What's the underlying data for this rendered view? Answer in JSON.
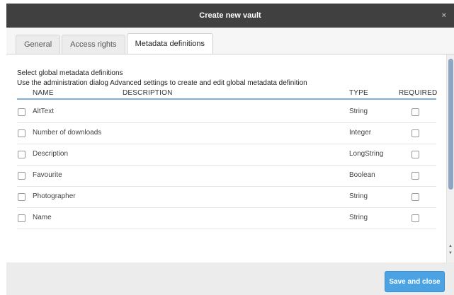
{
  "dialog": {
    "title": "Create new vault",
    "close_label": "×"
  },
  "tabs": [
    {
      "label": "General",
      "active": false
    },
    {
      "label": "Access rights",
      "active": false
    },
    {
      "label": "Metadata definitions",
      "active": true
    }
  ],
  "content": {
    "intro_line1": "Select global metadata definitions",
    "intro_line2": "Use the administration dialog Advanced settings to create and edit global metadata definition"
  },
  "table": {
    "headers": {
      "name": "NAME",
      "description": "DESCRIPTION",
      "type": "TYPE",
      "required": "REQUIRED"
    },
    "rows": [
      {
        "name": "AltText",
        "description": "",
        "type": "String",
        "selected": false,
        "required": false
      },
      {
        "name": "Number of downloads",
        "description": "",
        "type": "Integer",
        "selected": false,
        "required": false
      },
      {
        "name": "Description",
        "description": "",
        "type": "LongString",
        "selected": false,
        "required": false
      },
      {
        "name": "Favourite",
        "description": "",
        "type": "Boolean",
        "selected": false,
        "required": false
      },
      {
        "name": "Photographer",
        "description": "",
        "type": "String",
        "selected": false,
        "required": false
      },
      {
        "name": "Name",
        "description": "",
        "type": "String",
        "selected": false,
        "required": false
      }
    ]
  },
  "footer": {
    "save_label": "Save and close"
  },
  "colors": {
    "title_bar": "#404040",
    "accent": "#4ba3e3",
    "header_rule": "#7fb0d8"
  }
}
